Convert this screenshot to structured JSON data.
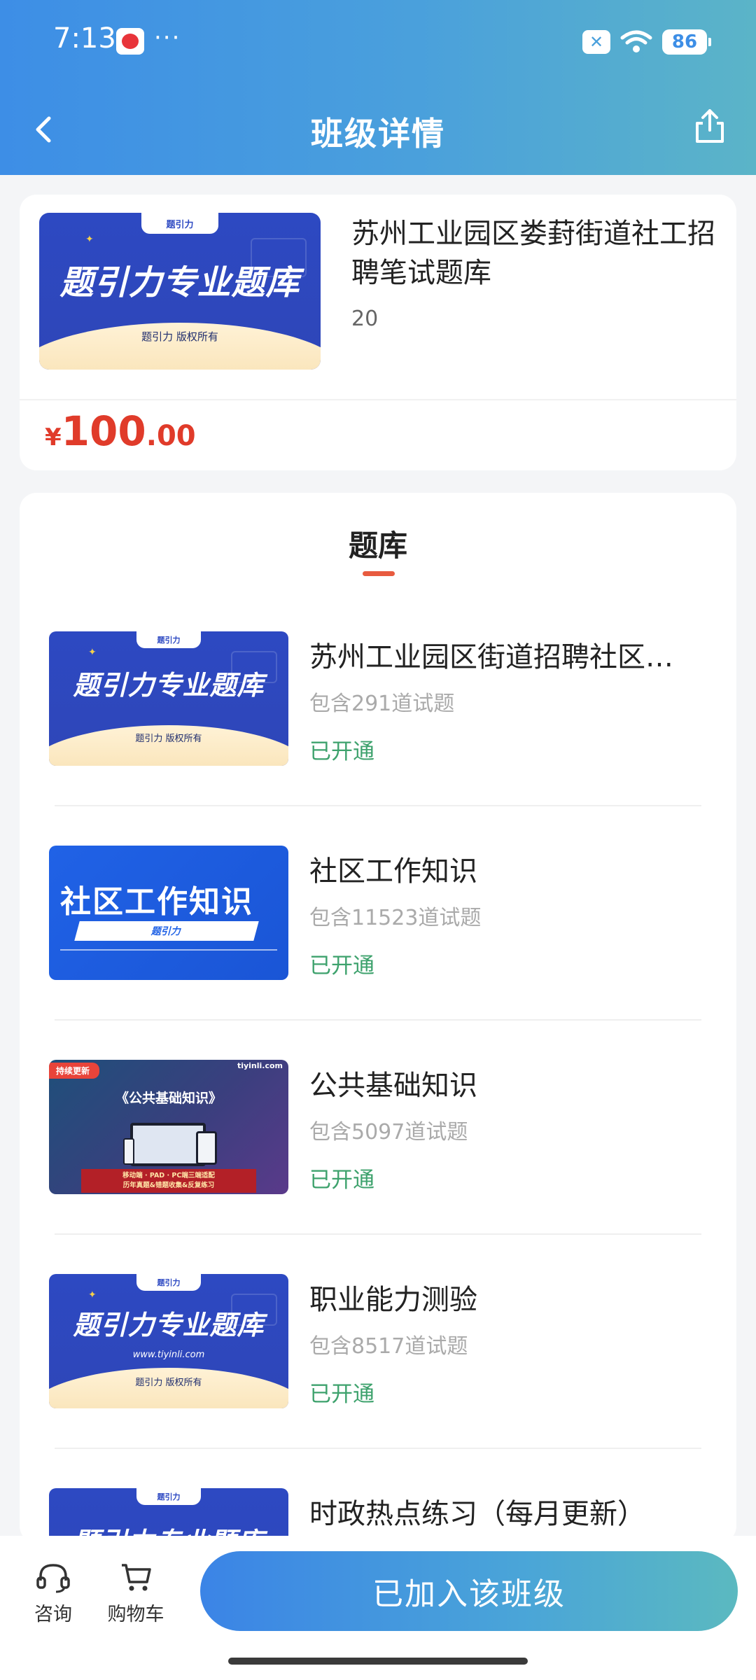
{
  "status_bar": {
    "time": "7:13",
    "dots": "···",
    "battery": "86",
    "sim_icon": "x-icon"
  },
  "header": {
    "title": "班级详情",
    "back_icon": "chevron-left-icon",
    "share_icon": "share-icon"
  },
  "product": {
    "title": "苏州工业园区娄葑街道社工招聘笔试题库",
    "count": "20",
    "price": {
      "currency": "¥",
      "integer": "100",
      "decimal": ".00"
    },
    "cover": {
      "tab": "题引力",
      "main": "题引力专业题库",
      "sub": "题引力 版权所有"
    }
  },
  "bank_section": {
    "title": "题库",
    "items": [
      {
        "title": "苏州工业园区街道招聘社区…",
        "count": "包含291道试题",
        "status": "已开通",
        "cover": {
          "tab": "题引力",
          "main": "题引力专业题库",
          "sub": "题引力 版权所有"
        }
      },
      {
        "title": "社区工作知识",
        "count": "包含11523道试题",
        "status": "已开通",
        "cover": {
          "main": "社区工作知识",
          "bar": "题引力"
        }
      },
      {
        "title": "公共基础知识",
        "count": "包含5097道试题",
        "status": "已开通",
        "cover": {
          "badge": "持续更新",
          "logo": "tiyinli.com",
          "main": "《公共基础知识》",
          "footer_line1": "移动端 · PAD · PC端三端适配",
          "footer_line2": "历年真题&错题收集&反复练习"
        }
      },
      {
        "title": "职业能力测验",
        "count": "包含8517道试题",
        "status": "已开通",
        "cover": {
          "tab": "题引力",
          "main": "题引力专业题库",
          "url": "www.tiyinli.com",
          "sub": "题引力 版权所有"
        }
      },
      {
        "title": "时政热点练习（每月更新）",
        "cover": {
          "tab": "题引力",
          "main": "题引力专业题库"
        }
      }
    ]
  },
  "bottom_bar": {
    "consult_label": "咨询",
    "cart_label": "购物车",
    "join_button": "已加入该班级"
  },
  "colors": {
    "header_gradient_start": "#3d8ee6",
    "header_gradient_end": "#5bb4c8",
    "price": "#e03b2a",
    "status_open": "#3ea26d",
    "tab_underline": "#e85b3f"
  }
}
